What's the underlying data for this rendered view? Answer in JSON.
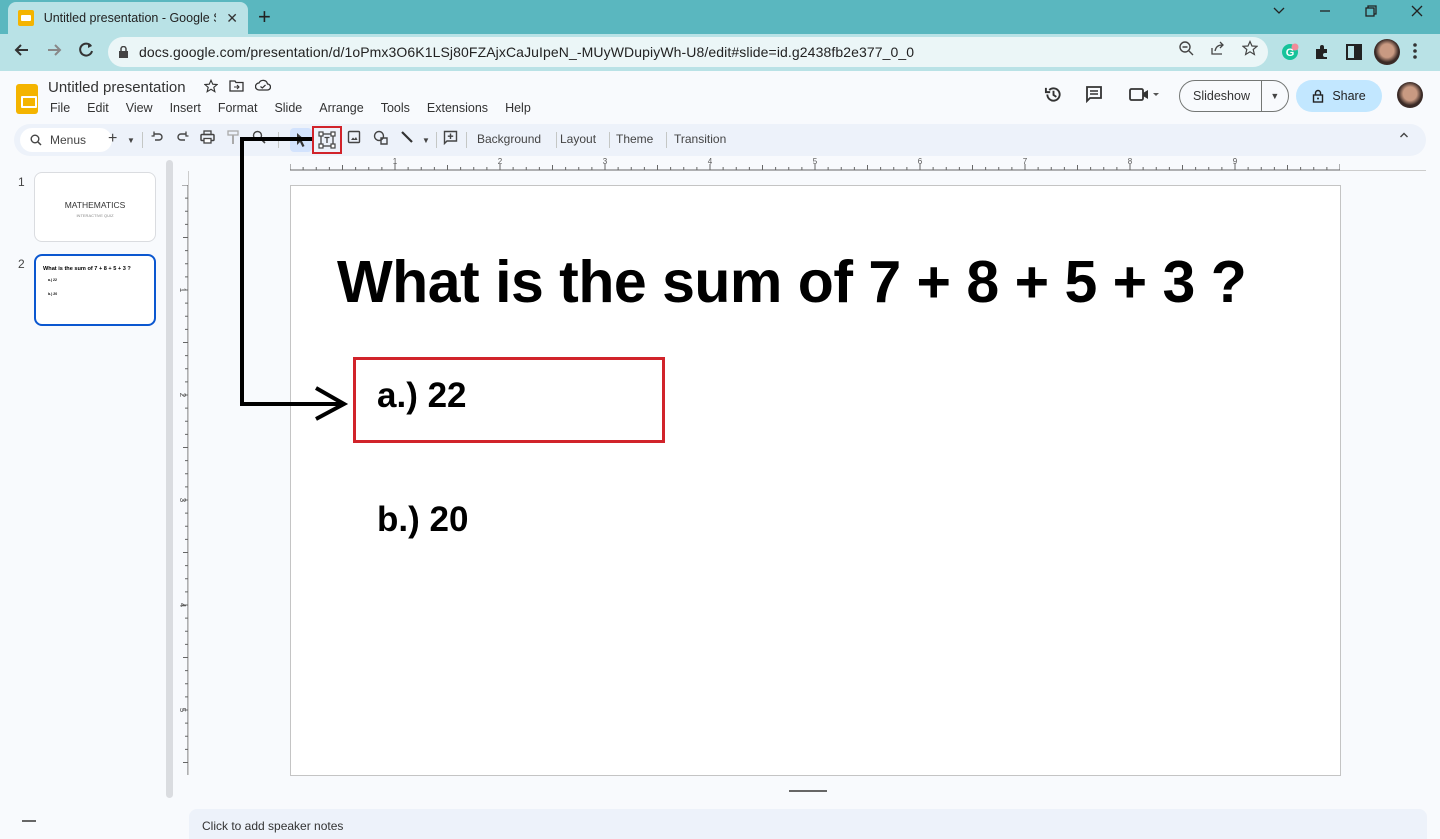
{
  "browser": {
    "tab_title": "Untitled presentation - Google Sl",
    "url": "docs.google.com/presentation/d/1oPmx3O6K1LSj80FZAjxCaJuIpeN_-MUyWDupiyWh-U8/edit#slide=id.g2438fb2e377_0_0",
    "new_tab_label": "+",
    "tab_close_label": "✕"
  },
  "docs": {
    "title": "Untitled presentation",
    "menu": [
      "File",
      "Edit",
      "View",
      "Insert",
      "Format",
      "Slide",
      "Arrange",
      "Tools",
      "Extensions",
      "Help"
    ],
    "slideshow_label": "Slideshow",
    "share_label": "Share"
  },
  "toolbar": {
    "menus_search_label": "Menus",
    "background_label": "Background",
    "layout_label": "Layout",
    "theme_label": "Theme",
    "transition_label": "Transition",
    "highlighted_tool": "text-box-icon"
  },
  "filmstrip": {
    "slides": [
      {
        "number": "1",
        "title": "MATHEMATICS",
        "subtitle": "INTERACTIVE QUIZ"
      },
      {
        "number": "2",
        "title": "What is the sum of 7 + 8 + 5 + 3 ?",
        "lines": [
          "a.) 22",
          "b.) 20"
        ]
      }
    ],
    "active_slide": 2
  },
  "rulers": {
    "horizontal": [
      "1",
      "2",
      "3",
      "4",
      "5",
      "6",
      "7",
      "8",
      "9"
    ],
    "vertical": [
      "1",
      "2",
      "3",
      "4",
      "5"
    ]
  },
  "slide": {
    "title": "What is the sum of 7 + 8 + 5 + 3 ?",
    "answers": [
      "a.) 22",
      "b.) 20"
    ]
  },
  "notes": {
    "placeholder": "Click to add speaker notes"
  },
  "colors": {
    "annotation_red": "#d1232a",
    "chrome_teal": "#5ab7bf",
    "share_blue": "#c2e7ff",
    "active_thumb_blue": "#0b57d0"
  }
}
